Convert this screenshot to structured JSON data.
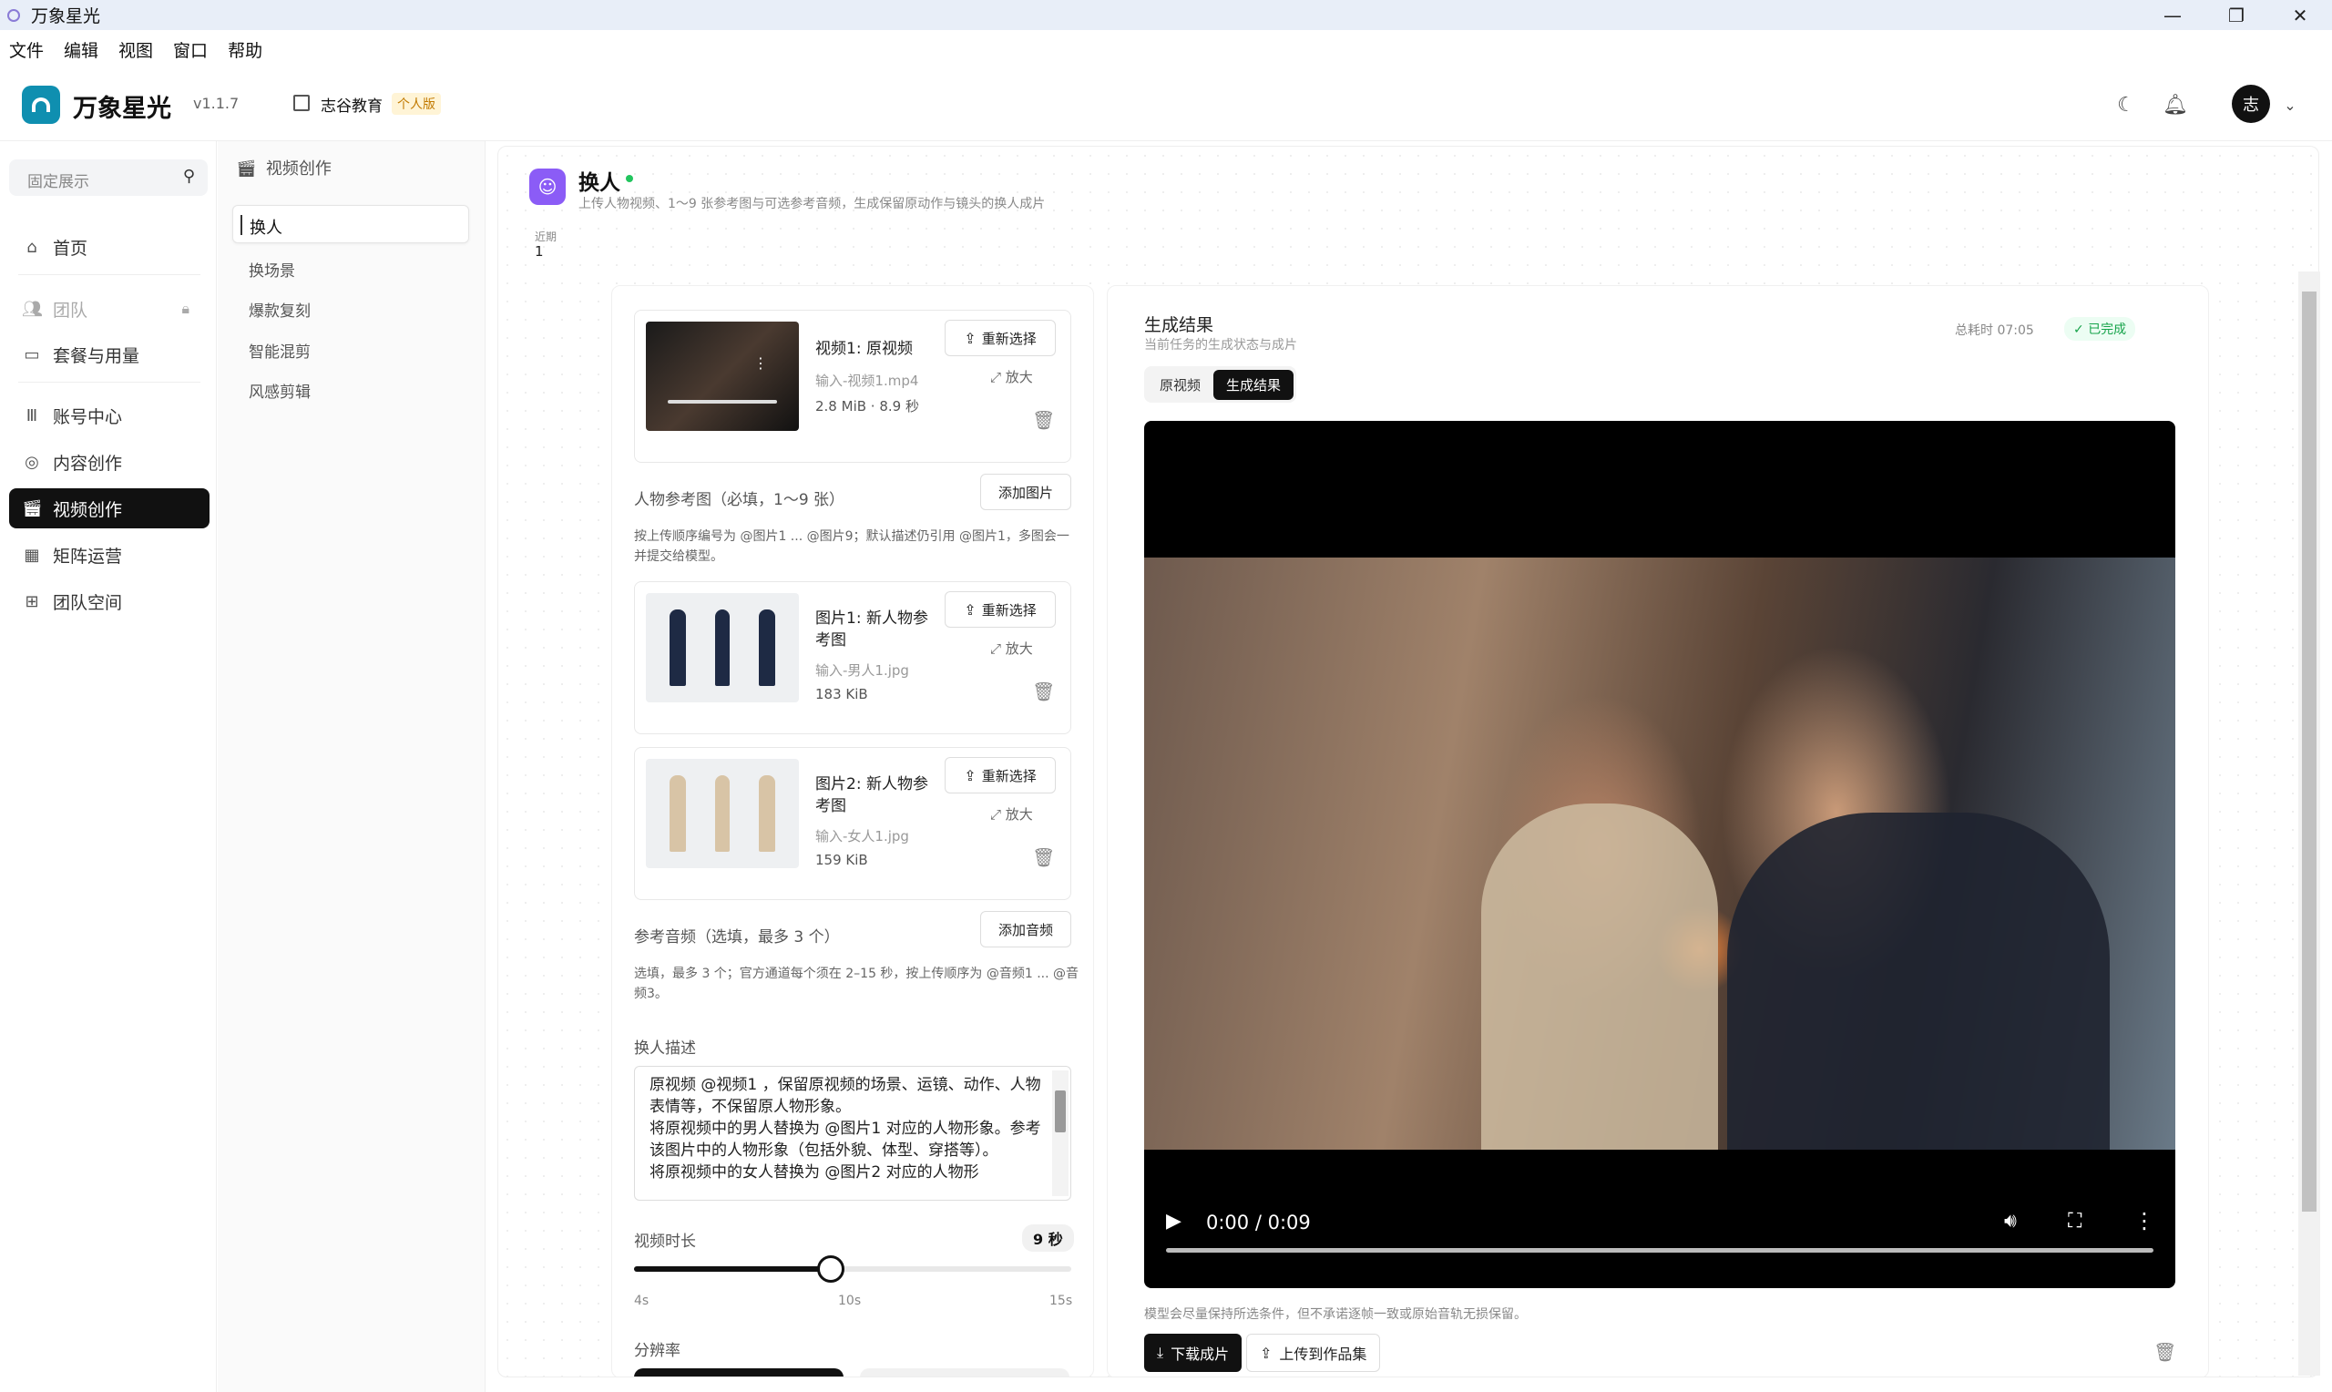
{
  "window": {
    "title": "万象星光"
  },
  "menu": [
    "文件",
    "编辑",
    "视图",
    "窗口",
    "帮助"
  ],
  "header": {
    "brand": "万象星光",
    "version": "v1.1.7",
    "org": "志谷教育",
    "plan": "个人版",
    "avatar": "志"
  },
  "sidebar": {
    "pin_label": "固定展示",
    "items": [
      {
        "label": "首页",
        "icon": "home-icon"
      },
      {
        "label": "团队",
        "icon": "users-icon",
        "locked": true
      },
      {
        "label": "套餐与用量",
        "icon": "card-icon"
      },
      {
        "label": "账号中心",
        "icon": "library-icon"
      },
      {
        "label": "内容创作",
        "icon": "target-icon"
      },
      {
        "label": "视频创作",
        "icon": "clapper-icon",
        "active": true
      },
      {
        "label": "矩阵运营",
        "icon": "grid-icon"
      },
      {
        "label": "团队空间",
        "icon": "apps-icon"
      }
    ]
  },
  "subnav": {
    "title": "视频创作",
    "items": [
      "换人",
      "换场景",
      "爆款复刻",
      "智能混剪",
      "风感剪辑"
    ]
  },
  "page": {
    "title": "换人",
    "desc": "上传人物视频、1～9 张参考图与可选参考音频，生成保留原动作与镜头的换人成片",
    "recent_label": "近期",
    "recent_value": "1"
  },
  "form": {
    "video_card": {
      "name": "视频1: 原视频",
      "file": "输入-视频1.mp4",
      "size": "2.8 MiB · 8.9 秒"
    },
    "reselect": "重新选择",
    "zoom": "放大",
    "ref_label": "人物参考图（必填，1～9 张）",
    "add_image": "添加图片",
    "ref_note": "按上传顺序编号为 @图片1 ... @图片9；默认描述仍引用 @图片1，多图会一并提交给模型。",
    "images": [
      {
        "name": "图片1: 新人物参考图",
        "file": "输入-男人1.jpg",
        "size": "183 KiB"
      },
      {
        "name": "图片2: 新人物参考图",
        "file": "输入-女人1.jpg",
        "size": "159 KiB"
      }
    ],
    "audio_label": "参考音频（选填，最多 3 个）",
    "add_audio": "添加音频",
    "audio_note": "选填，最多 3 个；官方通道每个须在 2–15 秒，按上传顺序为 @音频1 ... @音频3。",
    "desc_label": "换人描述",
    "desc_text": "原视频 @视频1 ，保留原视频的场景、运镜、动作、人物表情等，不保留原人物形象。\n将原视频中的男人替换为 @图片1 对应的人物形象。参考该图片中的人物形象（包括外貌、体型、穿搭等）。\n将原视频中的女人替换为 @图片2 对应的人物形",
    "duration_label": "视频时长",
    "duration_value": "9 秒",
    "duration_fraction": 0.45,
    "ticks": [
      "4s",
      "10s",
      "15s"
    ],
    "resolution_label": "分辨率"
  },
  "result": {
    "title": "生成结果",
    "desc": "当前任务的生成状态与成片",
    "time": "总耗时 07:05",
    "status": "已完成",
    "tabs": [
      "原视频",
      "生成结果"
    ],
    "active_tab": 1,
    "video_time": "0:00 / 0:09",
    "note": "模型会尽量保持所选条件，但不承诺逐帧一致或原始音轨无损保留。",
    "download": "下载成片",
    "upload": "上传到作品集"
  },
  "colors": {
    "accent": "#111111",
    "brand": "#0f8fb0",
    "page_icon": "#8b5cf6",
    "success": "#16a34a"
  }
}
